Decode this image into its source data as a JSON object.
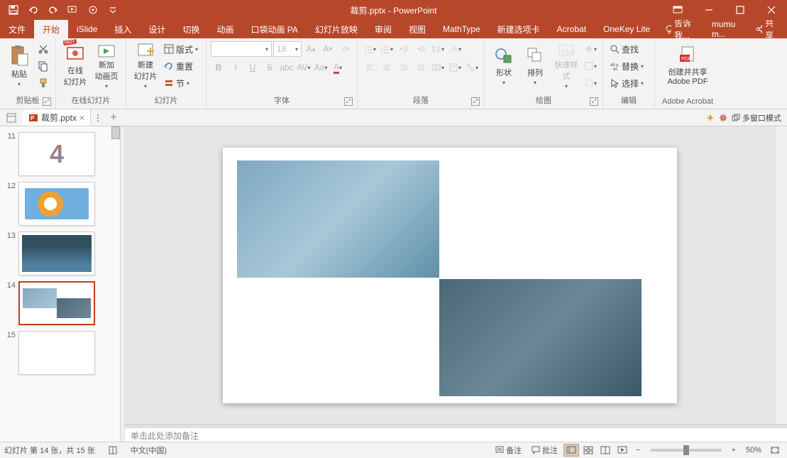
{
  "title_bar": {
    "document_title": "裁剪.pptx - PowerPoint"
  },
  "tabs": {
    "file": "文件",
    "home": "开始",
    "islide": "iSlide",
    "insert": "插入",
    "design": "设计",
    "transitions": "切换",
    "animations": "动画",
    "pocket_anim": "口袋动画 PA",
    "slideshow": "幻灯片放映",
    "review": "审阅",
    "view": "视图",
    "mathtype": "MathType",
    "new_tab": "新建选项卡",
    "acrobat": "Acrobat",
    "onekey": "OneKey Lite",
    "tell_me": "告诉我...",
    "user": "mumu m...",
    "share": "共享"
  },
  "ribbon": {
    "clipboard": {
      "paste": "粘贴",
      "label": "剪贴板"
    },
    "online_slides": {
      "online": "在线\n幻灯片",
      "new_anim": "新加\n动画页",
      "label": "在线幻灯片"
    },
    "slides": {
      "new_slide": "新建\n幻灯片",
      "layout": "版式",
      "reset": "重置",
      "section": "节",
      "label": "幻灯片"
    },
    "font": {
      "name_placeholder": "",
      "size": "18",
      "label": "字体"
    },
    "paragraph": {
      "label": "段落"
    },
    "drawing": {
      "shapes": "形状",
      "arrange": "排列",
      "quick_styles": "快速样式",
      "label": "绘图"
    },
    "editing": {
      "find": "查找",
      "replace": "替换",
      "select": "选择",
      "label": "编辑"
    },
    "adobe": {
      "create_share": "创建并共享\nAdobe PDF",
      "label": "Adobe Acrobat"
    }
  },
  "doc_tabs": {
    "tab1": "裁剪.pptx",
    "multiwindow": "多窗口模式"
  },
  "thumbnails": [
    {
      "num": "11"
    },
    {
      "num": "12"
    },
    {
      "num": "13"
    },
    {
      "num": "14"
    },
    {
      "num": "15"
    }
  ],
  "notes": {
    "placeholder": "单击此处添加备注"
  },
  "status": {
    "slide_info": "幻灯片 第 14 张，共 15 张",
    "language": "中文(中国)",
    "notes_btn": "备注",
    "comments_btn": "批注",
    "zoom_level": "50%"
  }
}
